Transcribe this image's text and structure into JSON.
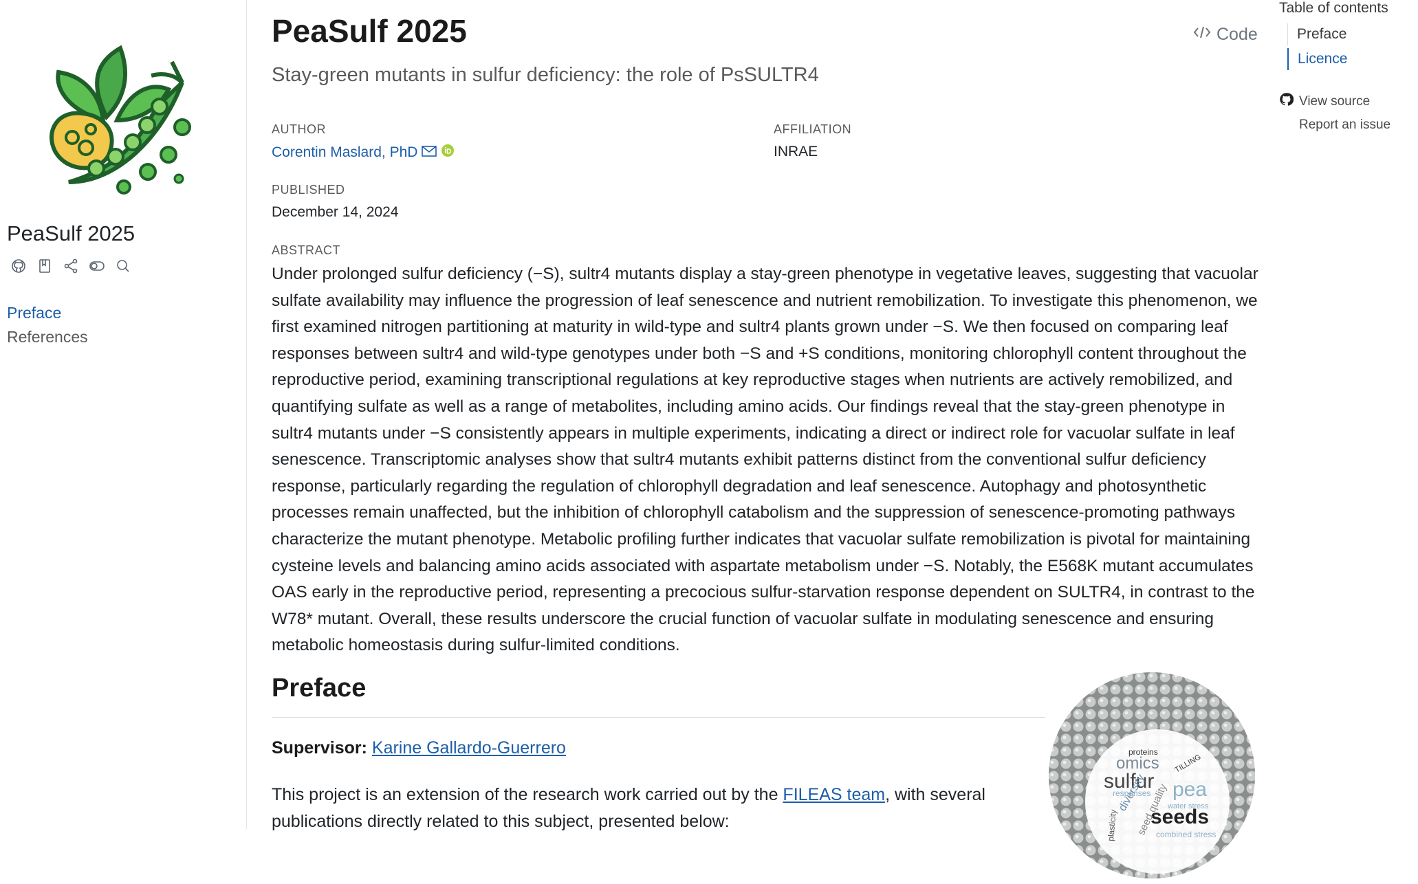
{
  "sidebar": {
    "title": "PeaSulf 2025",
    "tools": [
      "github-icon",
      "bookmark-icon",
      "share-icon",
      "toggle-icon",
      "search-icon"
    ],
    "nav": [
      {
        "label": "Preface",
        "active": true
      },
      {
        "label": "References",
        "active": false
      }
    ]
  },
  "header": {
    "title": "PeaSulf 2025",
    "subtitle": "Stay-green mutants in sulfur deficiency: the role of PsSULTR4",
    "code_label": "Code"
  },
  "meta": {
    "author_label": "AUTHOR",
    "author_name": "Corentin Maslard, PhD",
    "affiliation_label": "AFFILIATION",
    "affiliation_value": "INRAE",
    "published_label": "PUBLISHED",
    "published_value": "December 14, 2024",
    "abstract_label": "ABSTRACT"
  },
  "abstract": "Under prolonged sulfur deficiency (−S), sultr4 mutants display a stay-green phenotype in vegetative leaves, suggesting that vacuolar sulfate availability may influence the progression of leaf senescence and nutrient remobilization. To investigate this phenomenon, we first examined nitrogen partitioning at maturity in wild-type and sultr4 plants grown under −S. We then focused on comparing leaf responses between sultr4 and wild-type genotypes under both −S and +S conditions, monitoring chlorophyll content throughout the reproductive period, examining transcriptional regulations at key reproductive stages when nutrients are actively remobilized, and quantifying sulfate as well as a range of metabolites, including amino acids. Our findings reveal that the stay-green phenotype in sultr4 mutants under −S consistently appears in multiple experiments, indicating a direct or indirect role for vacuolar sulfate in leaf senescence. Transcriptomic analyses show that sultr4 mutants exhibit patterns distinct from the conventional sulfur deficiency response, particularly regarding the regulation of chlorophyll degradation and leaf senescence. Autophagy and photosynthetic processes remain unaffected, but the inhibition of chlorophyll catabolism and the suppression of senescence-promoting pathways characterize the mutant phenotype. Metabolic profiling further indicates that vacuolar sulfate remobilization is pivotal for maintaining cysteine levels and balancing amino acids associated with aspartate metabolism under −S. Notably, the E568K mutant accumulates OAS early in the reproductive period, representing a precocious sulfur-starvation response dependent on SULTR4, in contrast to the W78* mutant. Overall, these results underscore the crucial function of vacuolar sulfate in modulating senescence and ensuring metabolic homeostasis during sulfur-limited conditions.",
  "preface": {
    "heading": "Preface",
    "supervisor_label": "Supervisor:",
    "supervisor_name": "Karine Gallardo-Guerrero",
    "project_text_before": "This project is an extension of the research work carried out by the ",
    "team_link": "FILEAS team",
    "project_text_after": ", with several publications directly related to this subject, presented below:",
    "image_words": [
      "proteins",
      "omics",
      "sulfur",
      "pea",
      "seeds",
      "TILLING",
      "diversity",
      "seed quality",
      "water stress",
      "plasticity",
      "combined stress",
      "responses"
    ]
  },
  "toc": {
    "title": "Table of contents",
    "items": [
      {
        "label": "Preface",
        "current": false
      },
      {
        "label": "Licence",
        "current": true
      }
    ],
    "view_source": "View source",
    "report_issue": "Report an issue"
  },
  "colors": {
    "link": "#1d5ea8",
    "logo_green": "#2e8b3a",
    "logo_yellow": "#f2c94c"
  }
}
